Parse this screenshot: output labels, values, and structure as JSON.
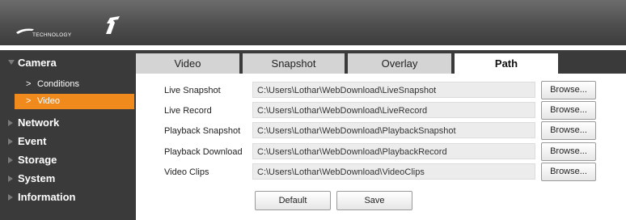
{
  "header": {
    "logo_text": "TECHNOLOGY",
    "logo_icon": "a-glyph-icon"
  },
  "sidebar": {
    "camera": "Camera",
    "conditions": "Conditions",
    "video": "Video",
    "network": "Network",
    "event": "Event",
    "storage": "Storage",
    "system": "System",
    "information": "Information",
    "sub_marker": ">"
  },
  "tabs": {
    "video": "Video",
    "snapshot": "Snapshot",
    "overlay": "Overlay",
    "path": "Path"
  },
  "rows": {
    "live_snapshot": {
      "label": "Live Snapshot",
      "value": "C:\\Users\\Lothar\\WebDownload\\LiveSnapshot"
    },
    "live_record": {
      "label": "Live Record",
      "value": "C:\\Users\\Lothar\\WebDownload\\LiveRecord"
    },
    "playback_snapshot": {
      "label": "Playback Snapshot",
      "value": "C:\\Users\\Lothar\\WebDownload\\PlaybackSnapshot"
    },
    "playback_download": {
      "label": "Playback Download",
      "value": "C:\\Users\\Lothar\\WebDownload\\PlaybackRecord"
    },
    "video_clips": {
      "label": "Video Clips",
      "value": "C:\\Users\\Lothar\\WebDownload\\VideoClips"
    }
  },
  "buttons": {
    "browse": "Browse...",
    "default": "Default",
    "save": "Save"
  },
  "colors": {
    "accent": "#f08a1c",
    "sidebar": "#3a3a3a",
    "header": "#555555"
  }
}
